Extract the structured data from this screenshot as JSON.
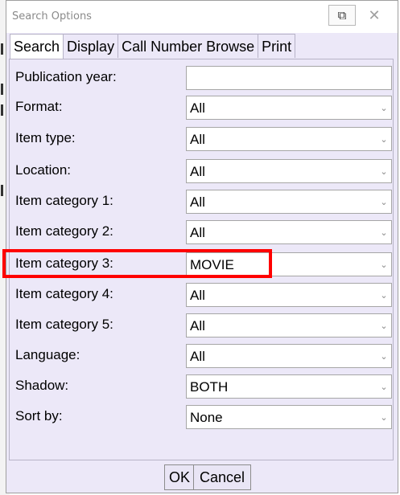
{
  "window": {
    "title": "Search Options",
    "restore_glyph": "⧉",
    "close_glyph": "✕"
  },
  "tabs": [
    {
      "label": "Search",
      "active": true
    },
    {
      "label": "Display",
      "active": false
    },
    {
      "label": "Call Number Browse",
      "active": false
    },
    {
      "label": "Print",
      "active": false
    }
  ],
  "fields": [
    {
      "label": "Publication year:",
      "kind": "input",
      "value": ""
    },
    {
      "label": "Format:",
      "kind": "select",
      "value": "All"
    },
    {
      "label": "Item type:",
      "kind": "select",
      "value": "All"
    },
    {
      "label": "Location:",
      "kind": "select",
      "value": "All"
    },
    {
      "label": "Item category 1:",
      "kind": "select",
      "value": "All"
    },
    {
      "label": "Item category 2:",
      "kind": "select",
      "value": "All"
    },
    {
      "label": "Item category 3:",
      "kind": "select",
      "value": "MOVIE"
    },
    {
      "label": "Item category 4:",
      "kind": "select",
      "value": "All"
    },
    {
      "label": "Item category 5:",
      "kind": "select",
      "value": "All"
    },
    {
      "label": "Language:",
      "kind": "select",
      "value": "All"
    },
    {
      "label": "Shadow:",
      "kind": "select",
      "value": "BOTH"
    },
    {
      "label": "Sort by:",
      "kind": "select",
      "value": "None"
    }
  ],
  "buttons": {
    "ok": "OK",
    "cancel": "Cancel"
  },
  "icons": {
    "dropdown_arrow": "⌄"
  },
  "colors": {
    "dialog_bg": "#ece8f8",
    "highlight": "#ff0000"
  }
}
